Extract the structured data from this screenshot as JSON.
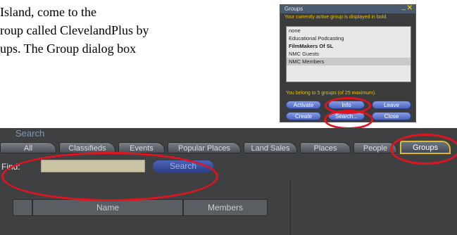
{
  "document": {
    "lines": [
      "Island, come to the",
      "roup called ClevelandPlus by",
      "ups.  The Group dialog box"
    ]
  },
  "groups_dialog": {
    "title": "Groups",
    "hint": "Your currently active group is displayed in bold.",
    "items": [
      "none",
      "Educational Podcasting",
      "FilmMakers Of SL",
      "NMC Guests",
      "NMC Members"
    ],
    "count_text": "You belong to 5 groups (of 25 maximum).",
    "buttons": {
      "activate": "Activate",
      "info": "Info",
      "leave": "Leave",
      "create": "Create",
      "search": "Search...",
      "close": "Close"
    }
  },
  "search_window": {
    "title": "Search",
    "tabs": [
      "All",
      "Classifieds",
      "Events",
      "Popular Places",
      "Land Sales",
      "Places",
      "People",
      "Groups"
    ],
    "find_label": "Find:",
    "search_button": "Search",
    "columns": [
      "Name",
      "Members"
    ]
  },
  "colors": {
    "highlight_ring": "#e0141e",
    "active_tab_border": "#e0b830"
  }
}
